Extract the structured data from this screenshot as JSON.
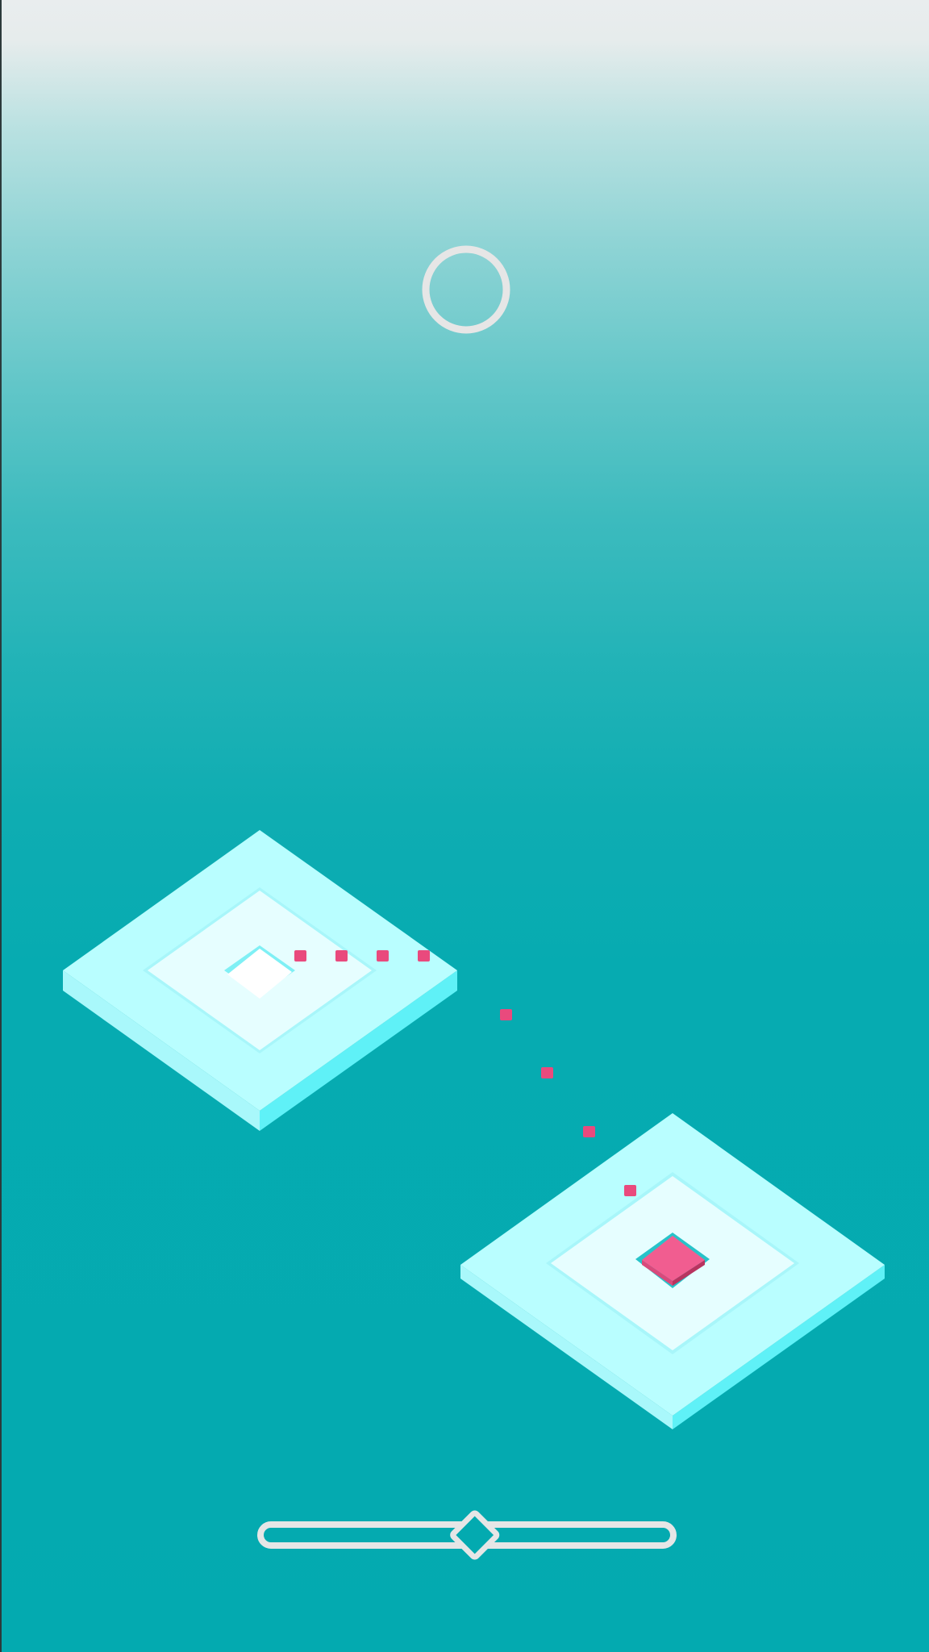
{
  "colors": {
    "tile_top": "#b9feff",
    "tile_inner": "#e6feff",
    "tile_center": "#ffffff",
    "tile_side_left": "#a9f8fb",
    "tile_side_right": "#5ff1f7",
    "player_top": "#f15d90",
    "player_side": "#c93b6c",
    "trail_dot": "#e94a7d",
    "ui_stroke": "#e6e6e6"
  },
  "hud": {
    "ring_icon": "ring-icon"
  },
  "slider": {
    "value": 0.52
  },
  "trail": {
    "dot_count": 8
  }
}
